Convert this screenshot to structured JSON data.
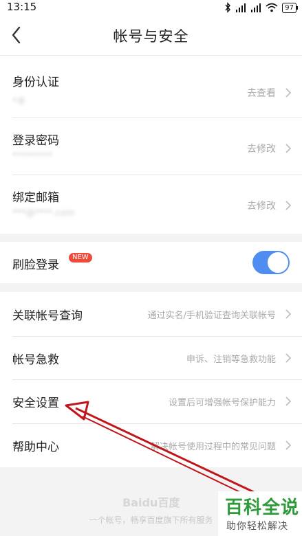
{
  "status_bar": {
    "time": "13:15",
    "battery": "97"
  },
  "header": {
    "title": "帐号与安全"
  },
  "section1": {
    "items": [
      {
        "title": "身份认证",
        "subtitle": "*羊",
        "action": "去查看"
      },
      {
        "title": "登录密码",
        "subtitle": "*********",
        "action": "去修改"
      },
      {
        "title": "绑定邮箱",
        "subtitle": "***@****.com",
        "action": "去修改"
      }
    ]
  },
  "section2": {
    "title": "刷脸登录",
    "badge": "NEW",
    "toggle_on": true
  },
  "section3": {
    "items": [
      {
        "title": "关联帐号查询",
        "action": "通过实名/手机验证查询关联帐号"
      },
      {
        "title": "帐号急救",
        "action": "申诉、注销等急救功能"
      },
      {
        "title": "安全设置",
        "action": "设置后可增强帐号保护能力"
      },
      {
        "title": "帮助中心",
        "action": "解决帐号使用过程中的常见问题"
      }
    ]
  },
  "footer": {
    "logo": "Baidu百度",
    "text": "一个帐号，畅享百度旗下所有服务"
  },
  "watermark": {
    "title": "百科全说",
    "subtitle": "助你轻松解决"
  },
  "colors": {
    "toggle": "#4f8ef0",
    "badge": "#f04a3b",
    "arrow": "#c0161b",
    "watermark": "#2e9b3b"
  }
}
